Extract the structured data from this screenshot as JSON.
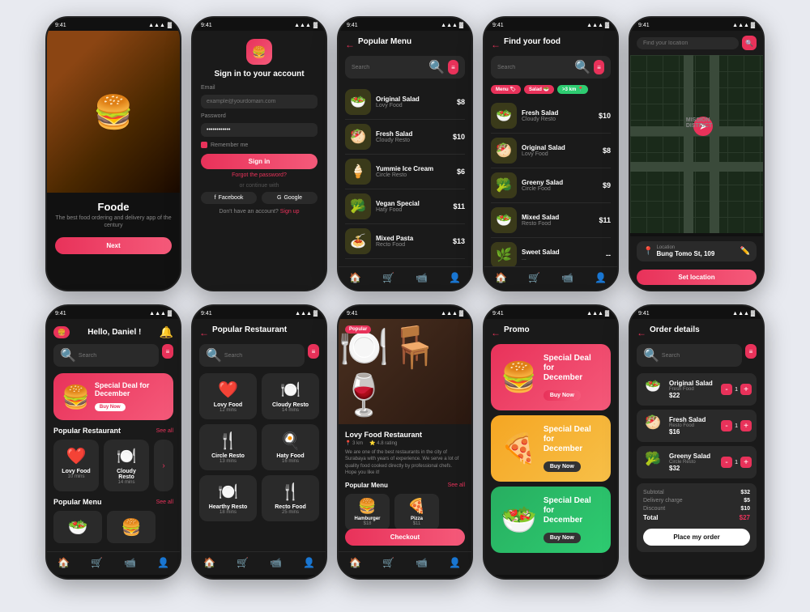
{
  "app": {
    "name": "Foode",
    "tagline": "The best food ordering and delivery app of the century"
  },
  "status_bar": {
    "time": "9:41",
    "signal": "●●●",
    "wifi": "▲",
    "battery": "🔋"
  },
  "screen1": {
    "app_name": "Foode",
    "tagline": "The best food ordering and delivery app of the century",
    "next_btn": "Next"
  },
  "screen2": {
    "title": "Sign in to your account",
    "email_label": "Email",
    "email_placeholder": "example@yourdomain.com",
    "password_label": "Password",
    "password_value": "••••••••••••",
    "remember_me": "Remember me",
    "signin_btn": "Sign in",
    "forgot_pw": "Forgot the password?",
    "or_text": "or continue with",
    "facebook": "Facebook",
    "google": "Google",
    "no_account": "Don't have an account?",
    "signup_link": "Sign up"
  },
  "screen3": {
    "title": "Popular Menu",
    "search_placeholder": "Search",
    "items": [
      {
        "name": "Original Salad",
        "resto": "Lovy Food",
        "price": "$8",
        "emoji": "🥗"
      },
      {
        "name": "Fresh Salad",
        "resto": "Cloudy Resto",
        "price": "$10",
        "emoji": "🥙"
      },
      {
        "name": "Yummie Ice Cream",
        "resto": "Circle Resto",
        "price": "$6",
        "emoji": "🍦"
      },
      {
        "name": "Vegan Special",
        "resto": "Haty Food",
        "price": "$11",
        "emoji": "🥦"
      },
      {
        "name": "Mixed Pasta",
        "resto": "Recto Food",
        "price": "$13",
        "emoji": "🍝"
      }
    ],
    "nav": [
      "Home",
      "🛒",
      "📹",
      "👤"
    ]
  },
  "screen4": {
    "title": "Find your food",
    "search_placeholder": "Search",
    "tags": [
      "Menu 🏷",
      "Salad 🥗",
      ">3 km 📍"
    ],
    "items": [
      {
        "name": "Fresh Salad",
        "resto": "Cloudy Resto",
        "price": "$10",
        "emoji": "🥗"
      },
      {
        "name": "Original Salad",
        "resto": "Lovy Food",
        "price": "$8",
        "emoji": "🥙"
      },
      {
        "name": "Greeny Salad",
        "resto": "Circle Food",
        "price": "$9",
        "emoji": "🥦"
      },
      {
        "name": "Mixed Salad",
        "resto": "Resto Food",
        "price": "$11",
        "emoji": "🥗"
      },
      {
        "name": "Sweet Salad",
        "resto": "...",
        "price": "--",
        "emoji": "🌿"
      }
    ]
  },
  "screen5": {
    "title": "Find your location",
    "search_placeholder": "Find your location",
    "location_label": "Location",
    "location_value": "Bung Tomo St, 109",
    "set_location_btn": "Set location"
  },
  "screen6": {
    "greeting": "Hello, Daniel !",
    "search_placeholder": "Search",
    "promo_title": "Special Deal for December",
    "buy_now_btn": "Buy Now",
    "popular_restaurant": "Popular Restaurant",
    "see_all": "See all",
    "popular_menu": "Popular Menu",
    "see_all2": "See all",
    "restaurants": [
      {
        "name": "Lovy Food",
        "time": "10 mins",
        "icon": "❤️"
      },
      {
        "name": "Cloudy Resto",
        "time": "14 mins",
        "icon": "🍽️"
      }
    ]
  },
  "screen7": {
    "title": "Popular Restaurant",
    "search_placeholder": "Search",
    "restaurants": [
      {
        "name": "Lovy Food",
        "time": "12 mins",
        "icon": "❤️"
      },
      {
        "name": "Cloudy Resto",
        "time": "14 mins",
        "icon": "🍽️"
      },
      {
        "name": "Circle Resto",
        "time": "13 mins",
        "icon": "🍴"
      },
      {
        "name": "Haty Food",
        "time": "16 mins",
        "icon": "🍳"
      },
      {
        "name": "Hearthy Resto",
        "time": "18 mins",
        "icon": "🍽️"
      },
      {
        "name": "Recto Food",
        "time": "25 mins",
        "icon": "🍴"
      }
    ]
  },
  "screen8": {
    "restaurant_name": "Lovy Food Restaurant",
    "badge": "Popular",
    "distance": "3 km",
    "rating": "4.8 rating",
    "description": "We are one of the best restaurants in the city of Surabaya with years of experience. We serve a lot of quality food cooked directly by professional chefs. Hope you like it!",
    "popular_menu": "Popular Menu",
    "see_all": "See all",
    "menu_items": [
      {
        "name": "Hamburger",
        "price": "$18",
        "emoji": "🍔"
      },
      {
        "name": "Pizza",
        "price": "$11",
        "emoji": "🍕"
      }
    ],
    "checkout_btn": "Checkout"
  },
  "screen9": {
    "title": "Promo",
    "promos": [
      {
        "title": "Special Deal for December",
        "type": "pink",
        "emoji": "🍔",
        "btn": "Buy Now"
      },
      {
        "title": "Special Deal for December",
        "type": "yellow",
        "emoji": "🍕",
        "btn": "Buy Now"
      },
      {
        "title": "Special Deal for December",
        "type": "green",
        "emoji": "🥗",
        "btn": "Buy Now"
      }
    ]
  },
  "screen10": {
    "title": "Order details",
    "search_placeholder": "Search",
    "items": [
      {
        "name": "Original Salad",
        "sub": "Fresh Food",
        "price": "$22",
        "qty": "1",
        "emoji": "🥗"
      },
      {
        "name": "Fresh Salad",
        "sub": "Resto Food",
        "price": "$16",
        "qty": "1",
        "emoji": "🥙"
      },
      {
        "name": "Greeny Salad",
        "sub": "Circle Resto",
        "price": "$32",
        "qty": "1",
        "emoji": "🥦"
      }
    ],
    "subtotal_label": "Subtotal",
    "subtotal_value": "$32",
    "delivery_label": "Delivery charge",
    "delivery_value": "$5",
    "discount_label": "Discount",
    "discount_value": "$10",
    "total_label": "Total",
    "total_value": "$27",
    "place_order_btn": "Place my order"
  }
}
